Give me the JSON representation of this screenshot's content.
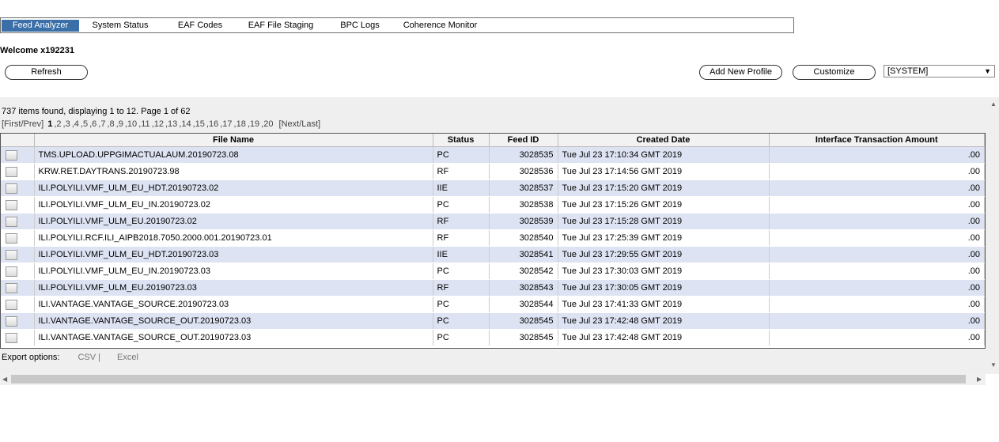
{
  "tabs": [
    {
      "label": "Feed Analyzer",
      "active": true
    },
    {
      "label": "System Status",
      "active": false
    },
    {
      "label": "EAF Codes",
      "active": false
    },
    {
      "label": "EAF File Staging",
      "active": false
    },
    {
      "label": "BPC Logs",
      "active": false
    },
    {
      "label": "Coherence Monitor",
      "active": false
    }
  ],
  "welcome": "Welcome x192231",
  "buttons": {
    "refresh": "Refresh",
    "add_profile": "Add New Profile",
    "customize": "Customize"
  },
  "profile_select": {
    "value": "[SYSTEM]",
    "arrow": "▼"
  },
  "summary": "737 items found, displaying 1 to 12. Page 1 of 62",
  "pager": {
    "first_prev": "[First/Prev]",
    "pages": [
      "1",
      "2",
      "3",
      "4",
      "5",
      "6",
      "7",
      "8",
      "9",
      "10",
      "11",
      "12",
      "13",
      "14",
      "15",
      "16",
      "17",
      "18",
      "19",
      "20"
    ],
    "current": "1",
    "next_last": "[Next/Last]"
  },
  "columns": [
    "",
    "File Name",
    "Status",
    "Feed ID",
    "Created Date",
    "Interface Transaction Amount"
  ],
  "rows": [
    {
      "file": "TMS.UPLOAD.UPPGIMACTUALAUM.20190723.08",
      "status": "PC",
      "feed_id": "3028535",
      "date": "Tue Jul 23 17:10:34 GMT 2019",
      "amount": ".00"
    },
    {
      "file": "KRW.RET.DAYTRANS.20190723.98",
      "status": "RF",
      "feed_id": "3028536",
      "date": "Tue Jul 23 17:14:56 GMT 2019",
      "amount": ".00"
    },
    {
      "file": "ILI.POLYILI.VMF_ULM_EU_HDT.20190723.02",
      "status": "IIE",
      "feed_id": "3028537",
      "date": "Tue Jul 23 17:15:20 GMT 2019",
      "amount": ".00"
    },
    {
      "file": "ILI.POLYILI.VMF_ULM_EU_IN.20190723.02",
      "status": "PC",
      "feed_id": "3028538",
      "date": "Tue Jul 23 17:15:26 GMT 2019",
      "amount": ".00"
    },
    {
      "file": "ILI.POLYILI.VMF_ULM_EU.20190723.02",
      "status": "RF",
      "feed_id": "3028539",
      "date": "Tue Jul 23 17:15:28 GMT 2019",
      "amount": ".00"
    },
    {
      "file": "ILI.POLYILI.RCF.ILI_AIPB2018.7050.2000.001.20190723.01",
      "status": "RF",
      "feed_id": "3028540",
      "date": "Tue Jul 23 17:25:39 GMT 2019",
      "amount": ".00"
    },
    {
      "file": "ILI.POLYILI.VMF_ULM_EU_HDT.20190723.03",
      "status": "IIE",
      "feed_id": "3028541",
      "date": "Tue Jul 23 17:29:55 GMT 2019",
      "amount": ".00"
    },
    {
      "file": "ILI.POLYILI.VMF_ULM_EU_IN.20190723.03",
      "status": "PC",
      "feed_id": "3028542",
      "date": "Tue Jul 23 17:30:03 GMT 2019",
      "amount": ".00"
    },
    {
      "file": "ILI.POLYILI.VMF_ULM_EU.20190723.03",
      "status": "RF",
      "feed_id": "3028543",
      "date": "Tue Jul 23 17:30:05 GMT 2019",
      "amount": ".00"
    },
    {
      "file": "ILI.VANTAGE.VANTAGE_SOURCE.20190723.03",
      "status": "PC",
      "feed_id": "3028544",
      "date": "Tue Jul 23 17:41:33 GMT 2019",
      "amount": ".00"
    },
    {
      "file": "ILI.VANTAGE.VANTAGE_SOURCE_OUT.20190723.03",
      "status": "PC",
      "feed_id": "3028545",
      "date": "Tue Jul 23 17:42:48 GMT 2019",
      "amount": ".00"
    },
    {
      "file": "ILI.VANTAGE.VANTAGE_SOURCE_OUT.20190723.03",
      "status": "PC",
      "feed_id": "3028545",
      "date": "Tue Jul 23 17:42:48 GMT 2019",
      "amount": ".00"
    }
  ],
  "export": {
    "label": "Export options:",
    "csv": "CSV |",
    "excel": "Excel"
  },
  "colors": {
    "active_tab": "#3b6fa8",
    "alt_row": "#dde3f2",
    "panel": "#efefef"
  }
}
